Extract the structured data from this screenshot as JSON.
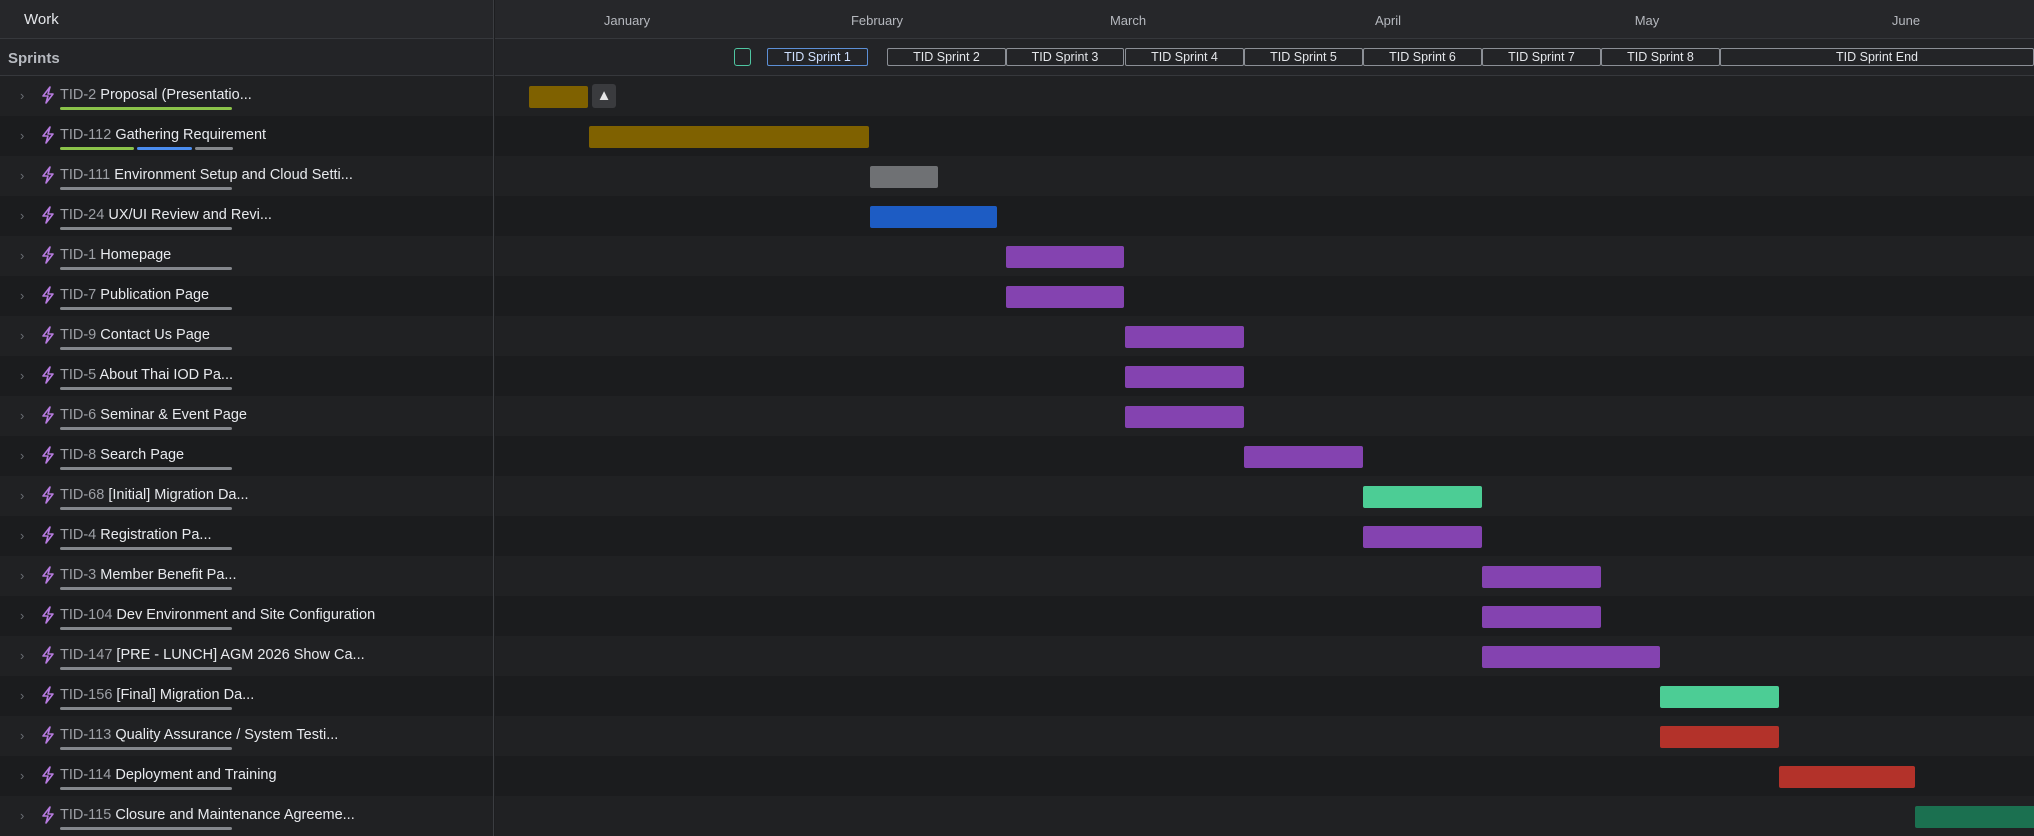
{
  "left": {
    "work_label": "Work",
    "sprints_label": "Sprints"
  },
  "months": [
    "January",
    "February",
    "March",
    "April",
    "May",
    "June"
  ],
  "sprints": [
    "TID Sprint 1",
    "TID Sprint 2",
    "TID Sprint 3",
    "TID Sprint 4",
    "TID Sprint 5",
    "TID Sprint 6",
    "TID Sprint 7",
    "TID Sprint 8",
    "TID Sprint End"
  ],
  "colors": {
    "gold": "#7f6100",
    "blue": "#1d5cc4",
    "gray": "#6f7174",
    "purple": "#8443b0",
    "teal": "#4ccd95",
    "red": "#b3322a",
    "darkgreen": "#1b7050",
    "progress_green": "#8bc34a",
    "progress_blue": "#4b8df0",
    "progress_gray": "#84878c"
  },
  "icons": {
    "chevron": "chevron-right-icon",
    "task": "lightning-bolt-icon",
    "warning": "warning-triangle-icon"
  },
  "tasks": [
    {
      "key": "TID-2",
      "title": "Proposal (Presentatio...",
      "progress": [
        [
          "progress_green",
          1
        ]
      ]
    },
    {
      "key": "TID-112",
      "title": "Gathering Requirement",
      "progress": [
        [
          "progress_green",
          0.44
        ],
        [
          "progress_blue",
          0.33
        ],
        [
          "progress_gray",
          0.23
        ]
      ]
    },
    {
      "key": "TID-111",
      "title": "Environment Setup and Cloud Setti...",
      "progress": [
        [
          "progress_gray",
          1
        ]
      ]
    },
    {
      "key": "TID-24",
      "title": "UX/UI Review and Revi...",
      "progress": [
        [
          "progress_gray",
          1
        ]
      ]
    },
    {
      "key": "TID-1",
      "title": "Homepage",
      "progress": [
        [
          "progress_gray",
          1
        ]
      ]
    },
    {
      "key": "TID-7",
      "title": "Publication Page",
      "progress": [
        [
          "progress_gray",
          1
        ]
      ]
    },
    {
      "key": "TID-9",
      "title": "Contact Us Page",
      "progress": [
        [
          "progress_gray",
          1
        ]
      ]
    },
    {
      "key": "TID-5",
      "title": "About Thai IOD Pa...",
      "progress": [
        [
          "progress_gray",
          1
        ]
      ]
    },
    {
      "key": "TID-6",
      "title": "Seminar & Event Page",
      "progress": [
        [
          "progress_gray",
          1
        ]
      ]
    },
    {
      "key": "TID-8",
      "title": "Search Page",
      "progress": [
        [
          "progress_gray",
          1
        ]
      ]
    },
    {
      "key": "TID-68",
      "title": "[Initial] Migration Da...",
      "progress": [
        [
          "progress_gray",
          1
        ]
      ]
    },
    {
      "key": "TID-4",
      "title": "Registration Pa...",
      "progress": [
        [
          "progress_gray",
          1
        ]
      ]
    },
    {
      "key": "TID-3",
      "title": "Member Benefit Pa...",
      "progress": [
        [
          "progress_gray",
          1
        ]
      ]
    },
    {
      "key": "TID-104",
      "title": "Dev Environment and Site Configuration",
      "progress": [
        [
          "progress_gray",
          1
        ]
      ]
    },
    {
      "key": "TID-147",
      "title": "[PRE - LUNCH] AGM 2026 Show Ca...",
      "progress": [
        [
          "progress_gray",
          1
        ]
      ]
    },
    {
      "key": "TID-156",
      "title": "[Final] Migration Da...",
      "progress": [
        [
          "progress_gray",
          1
        ]
      ]
    },
    {
      "key": "TID-113",
      "title": "Quality Assurance / System Testi...",
      "progress": [
        [
          "progress_gray",
          1
        ]
      ]
    },
    {
      "key": "TID-114",
      "title": "Deployment and Training",
      "progress": [
        [
          "progress_gray",
          1
        ]
      ]
    },
    {
      "key": "TID-115",
      "title": "Closure and Maintenance Agreeme...",
      "progress": [
        [
          "progress_gray",
          1
        ]
      ]
    }
  ]
}
